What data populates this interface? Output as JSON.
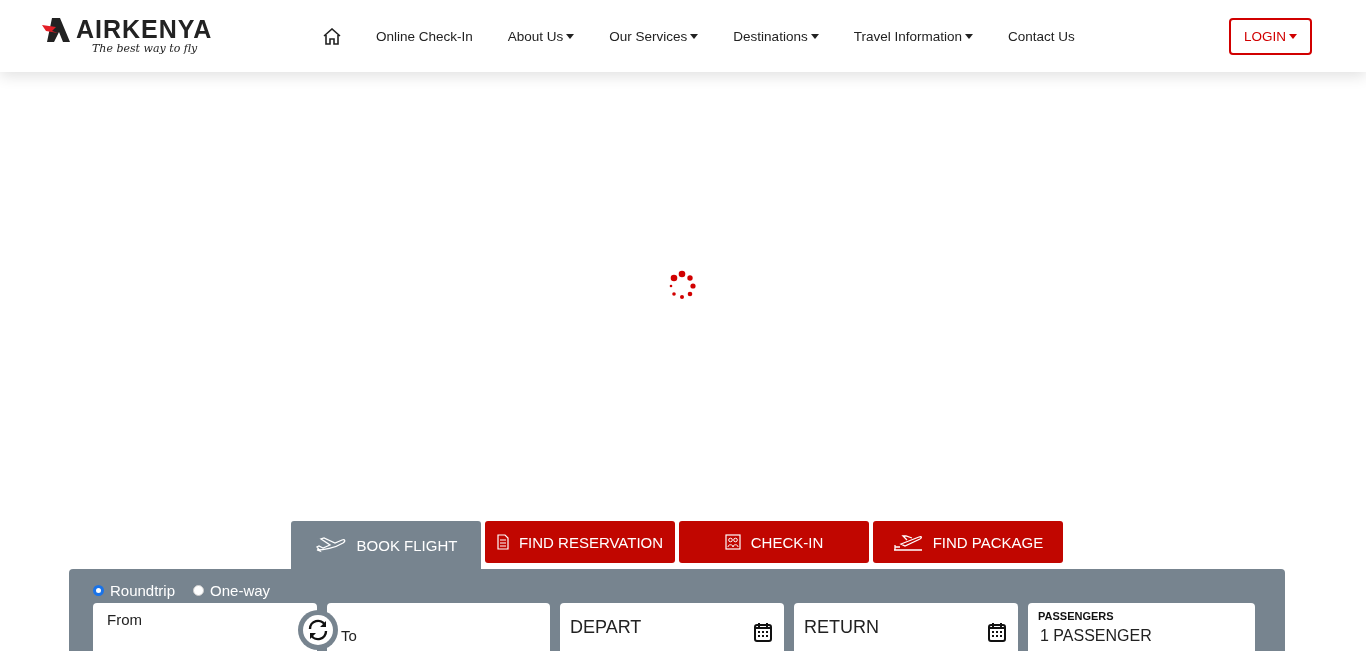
{
  "logo": {
    "name": "AIRKENYA",
    "tagline": "The best way to fly"
  },
  "nav": [
    {
      "label": "Online Check-In",
      "dropdown": false
    },
    {
      "label": "About Us",
      "dropdown": true
    },
    {
      "label": "Our Services",
      "dropdown": true
    },
    {
      "label": "Destinations",
      "dropdown": true
    },
    {
      "label": "Travel Information",
      "dropdown": true
    },
    {
      "label": "Contact Us",
      "dropdown": false
    }
  ],
  "login": {
    "label": "LOGIN",
    "dropdown": true
  },
  "booking_tabs": [
    {
      "label": "BOOK FLIGHT",
      "kind": "plane",
      "selected": true
    },
    {
      "label": "FIND RESERVATION",
      "kind": "document",
      "selected": false
    },
    {
      "label": "CHECK-IN",
      "kind": "people",
      "selected": false
    },
    {
      "label": "FIND PACKAGE",
      "kind": "departure",
      "selected": false
    }
  ],
  "trip_types": [
    {
      "label": "Roundtrip",
      "selected": true
    },
    {
      "label": "One-way",
      "selected": false
    }
  ],
  "fields": [
    {
      "kind": "from",
      "placeholder": "From"
    },
    {
      "kind": "to",
      "placeholder": "To"
    },
    {
      "kind": "date",
      "placeholder": "DEPART"
    },
    {
      "kind": "date",
      "placeholder": "RETURN"
    },
    {
      "kind": "passengers",
      "label": "PASSENGERS",
      "value": "1 PASSENGER"
    }
  ]
}
